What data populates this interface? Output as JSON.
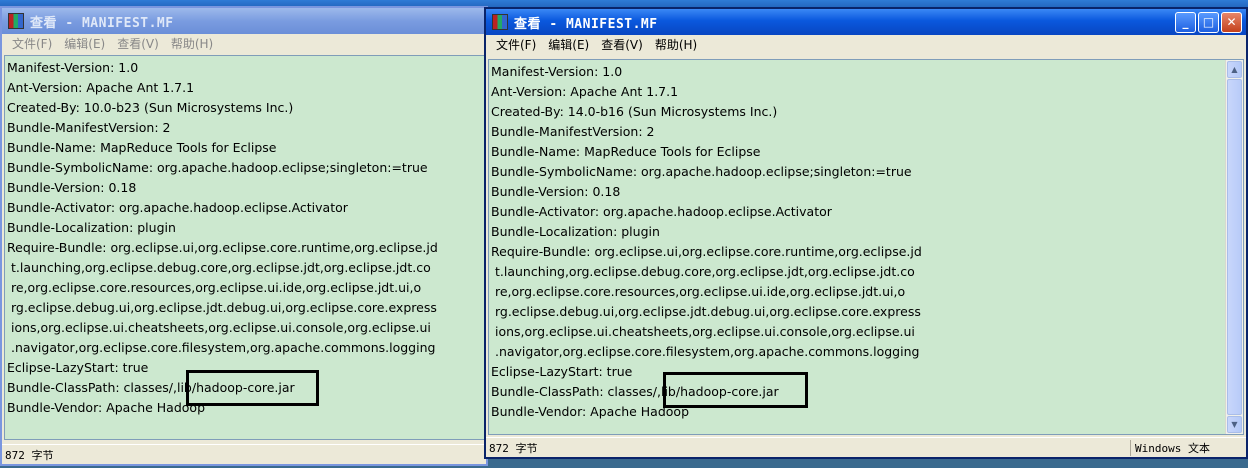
{
  "left_window": {
    "title": "查看 - MANIFEST.MF",
    "menu": [
      "文件(F)",
      "编辑(E)",
      "查看(V)",
      "帮助(H)"
    ],
    "status": "872 字节"
  },
  "right_window": {
    "title": "查看 - MANIFEST.MF",
    "menu": [
      "文件(F)",
      "编辑(E)",
      "查看(V)",
      "帮助(H)"
    ],
    "status_left": "872 字节",
    "status_right": "Windows 文本"
  },
  "left_lines": [
    "Manifest-Version: 1.0",
    "Ant-Version: Apache Ant 1.7.1",
    "Created-By: 10.0-b23 (Sun Microsystems Inc.)",
    "Bundle-ManifestVersion: 2",
    "Bundle-Name: MapReduce Tools for Eclipse",
    "Bundle-SymbolicName: org.apache.hadoop.eclipse;singleton:=true",
    "Bundle-Version: 0.18",
    "Bundle-Activator: org.apache.hadoop.eclipse.Activator",
    "Bundle-Localization: plugin",
    "Require-Bundle: org.eclipse.ui,org.eclipse.core.runtime,org.eclipse.jd",
    " t.launching,org.eclipse.debug.core,org.eclipse.jdt,org.eclipse.jdt.co",
    " re,org.eclipse.core.resources,org.eclipse.ui.ide,org.eclipse.jdt.ui,o",
    " rg.eclipse.debug.ui,org.eclipse.jdt.debug.ui,org.eclipse.core.express",
    " ions,org.eclipse.ui.cheatsheets,org.eclipse.ui.console,org.eclipse.ui",
    " .navigator,org.eclipse.core.filesystem,org.apache.commons.logging",
    "Eclipse-LazyStart: true",
    "Bundle-ClassPath: classes/,lib/hadoop-core.jar",
    "Bundle-Vendor: Apache Hadoop"
  ],
  "right_lines": [
    "Manifest-Version: 1.0",
    "Ant-Version: Apache Ant 1.7.1",
    "Created-By: 14.0-b16 (Sun Microsystems Inc.)",
    "Bundle-ManifestVersion: 2",
    "Bundle-Name: MapReduce Tools for Eclipse",
    "Bundle-SymbolicName: org.apache.hadoop.eclipse;singleton:=true",
    "Bundle-Version: 0.18",
    "Bundle-Activator: org.apache.hadoop.eclipse.Activator",
    "Bundle-Localization: plugin",
    "Require-Bundle: org.eclipse.ui,org.eclipse.core.runtime,org.eclipse.jd",
    " t.launching,org.eclipse.debug.core,org.eclipse.jdt,org.eclipse.jdt.co",
    " re,org.eclipse.core.resources,org.eclipse.ui.ide,org.eclipse.jdt.ui,o",
    " rg.eclipse.debug.ui,org.eclipse.jdt.debug.ui,org.eclipse.core.express",
    " ions,org.eclipse.ui.cheatsheets,org.eclipse.ui.console,org.eclipse.ui",
    " .navigator,org.eclipse.core.filesystem,org.apache.commons.logging",
    "Eclipse-LazyStart: true",
    "Bundle-ClassPath: classes/,lib/hadoop-core.jar",
    "Bundle-Vendor: Apache Hadoop"
  ],
  "colors": {
    "content_bg": "#cce8cf",
    "titlebar_active": "#0a58dd",
    "titlebar_inactive": "#7a9ce0"
  },
  "icons": {
    "app": "winrar-books-icon",
    "minimize": "minimize-icon",
    "maximize": "maximize-icon",
    "close": "close-icon"
  }
}
